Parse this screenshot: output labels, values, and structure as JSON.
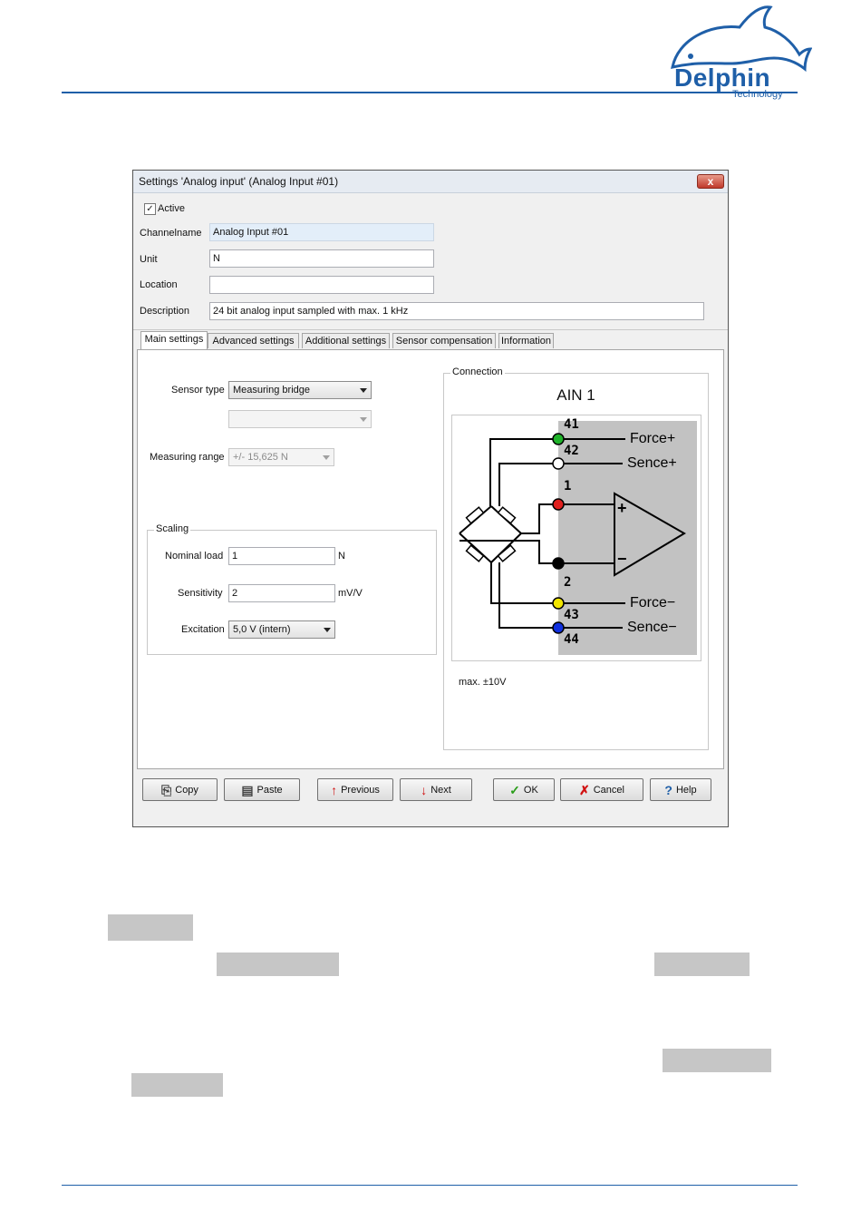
{
  "brand": {
    "logo_word": "Delphin",
    "logo_sub": "Technology",
    "color": "#1f5fa8"
  },
  "dialog": {
    "title": "Settings 'Analog input' (Analog Input #01)",
    "close_glyph": "x",
    "active_label": "Active",
    "active_checked": true,
    "channelname_label": "Channelname",
    "channelname_value": "Analog Input #01",
    "unit_label": "Unit",
    "unit_value": "N",
    "location_label": "Location",
    "location_value": "",
    "description_label": "Description",
    "description_value": "24 bit analog input sampled with max. 1 kHz",
    "tabs": [
      "Main settings",
      "Advanced settings",
      "Additional settings",
      "Sensor compensation",
      "Information"
    ],
    "active_tab": 0
  },
  "main": {
    "sensor_type_label": "Sensor type",
    "sensor_type_value": "Measuring bridge",
    "sub_type_value": "",
    "measuring_range_label": "Measuring range",
    "measuring_range_value": "+/- 15,625 N",
    "scaling_title": "Scaling",
    "nominal_load_label": "Nominal load",
    "nominal_load_value": "1",
    "nominal_load_unit": "N",
    "sensitivity_label": "Sensitivity",
    "sensitivity_value": "2",
    "sensitivity_unit": "mV/V",
    "excitation_label": "Excitation",
    "excitation_value": "5,0 V (intern)"
  },
  "connection": {
    "title": "Connection",
    "channel": "AIN 1",
    "note": "max. ±10V",
    "pins": [
      {
        "num": "41",
        "color": "#1fb32a",
        "label": "Force+"
      },
      {
        "num": "42",
        "color": "#ffffff",
        "label": "Sence+"
      },
      {
        "num": "1",
        "color": "#e0201e",
        "label": ""
      },
      {
        "num": "2",
        "color": "#000000",
        "label": ""
      },
      {
        "num": "43",
        "color": "#f2e600",
        "label": "Force−"
      },
      {
        "num": "44",
        "color": "#1030e0",
        "label": "Sence−"
      }
    ],
    "amp_plus": "+",
    "amp_minus": "−"
  },
  "buttons": {
    "copy": "Copy",
    "paste": "Paste",
    "previous": "Previous",
    "next": "Next",
    "ok": "OK",
    "cancel": "Cancel",
    "help": "Help"
  }
}
